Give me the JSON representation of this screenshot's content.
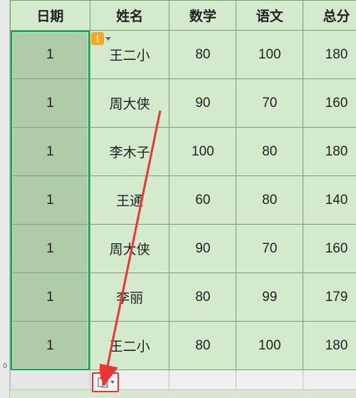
{
  "headers": {
    "date": "日期",
    "name": "姓名",
    "math": "数学",
    "chinese": "语文",
    "total": "总分"
  },
  "rows": [
    {
      "date": "1",
      "name": "王二小",
      "math": "80",
      "chinese": "100",
      "total": "180"
    },
    {
      "date": "1",
      "name": "周大侠",
      "math": "90",
      "chinese": "70",
      "total": "160"
    },
    {
      "date": "1",
      "name": "李木子",
      "math": "100",
      "chinese": "80",
      "total": "180"
    },
    {
      "date": "1",
      "name": "王通",
      "math": "60",
      "chinese": "80",
      "total": "140"
    },
    {
      "date": "1",
      "name": "周大侠",
      "math": "90",
      "chinese": "70",
      "total": "160"
    },
    {
      "date": "1",
      "name": "李丽",
      "math": "80",
      "chinese": "99",
      "total": "179"
    },
    {
      "date": "1",
      "name": "王二小",
      "math": "80",
      "chinese": "100",
      "total": "180"
    }
  ],
  "gutter_visible_row": "0",
  "icons": {
    "warning_mark": "!",
    "paste_options": "paste-options-icon"
  }
}
